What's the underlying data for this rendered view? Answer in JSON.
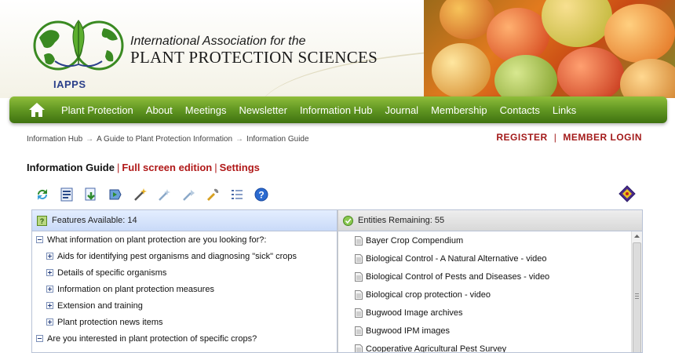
{
  "header": {
    "org_line1": "International Association for the",
    "org_line2": "PLANT PROTECTION SCIENCES",
    "logo_text": "IAPPS"
  },
  "nav": {
    "items": [
      "Plant Protection",
      "About",
      "Meetings",
      "Newsletter",
      "Information Hub",
      "Journal",
      "Membership",
      "Contacts",
      "Links"
    ]
  },
  "breadcrumb": {
    "items": [
      "Information Hub",
      "A Guide to Plant Protection Information",
      "Information Guide"
    ],
    "separator": "→"
  },
  "account": {
    "register": "REGISTER",
    "divider": "|",
    "login": "MEMBER LOGIN"
  },
  "guide": {
    "current": "Information Guide",
    "separator": "|",
    "full_screen": "Full screen edition",
    "settings": "Settings"
  },
  "toolbar": {
    "icons": [
      "restart-icon",
      "features-list-icon",
      "download-icon",
      "navigate-icon",
      "magic-wand-icon",
      "best-icon",
      "next-best-icon",
      "tools-icon",
      "list-icon",
      "help-icon"
    ],
    "right_icon": "lucid-logo-icon"
  },
  "features_panel": {
    "title": "Features Available: 14",
    "rows": [
      {
        "text": "What information on plant protection are you looking for?:",
        "level": 0,
        "expanded": true
      },
      {
        "text": "Aids for identifying pest organisms and diagnosing \"sick\" crops",
        "level": 1,
        "expanded": false
      },
      {
        "text": "Details of specific organisms",
        "level": 1,
        "expanded": false
      },
      {
        "text": "Information on plant protection measures",
        "level": 1,
        "expanded": false
      },
      {
        "text": "Extension and training",
        "level": 1,
        "expanded": false
      },
      {
        "text": "Plant protection news items",
        "level": 1,
        "expanded": false
      },
      {
        "text": "Are you interested in plant protection of specific crops?",
        "level": 0,
        "expanded": true
      }
    ]
  },
  "entities_panel": {
    "title": "Entities Remaining: 55",
    "rows": [
      "Bayer Crop Compendium",
      "Biological Control - A Natural Alternative - video",
      "Biological Control of Pests and Diseases - video",
      "Biological crop protection - video",
      "Bugwood Image archives",
      "Bugwood IPM images",
      "Cooperative Agricultural Pest Survey"
    ]
  },
  "colors": {
    "nav_green": "#5d9320",
    "link_red": "#b01818",
    "account_red": "#a31a1a",
    "logo_blue": "#2a3f8a",
    "logo_green": "#3a8a22"
  }
}
